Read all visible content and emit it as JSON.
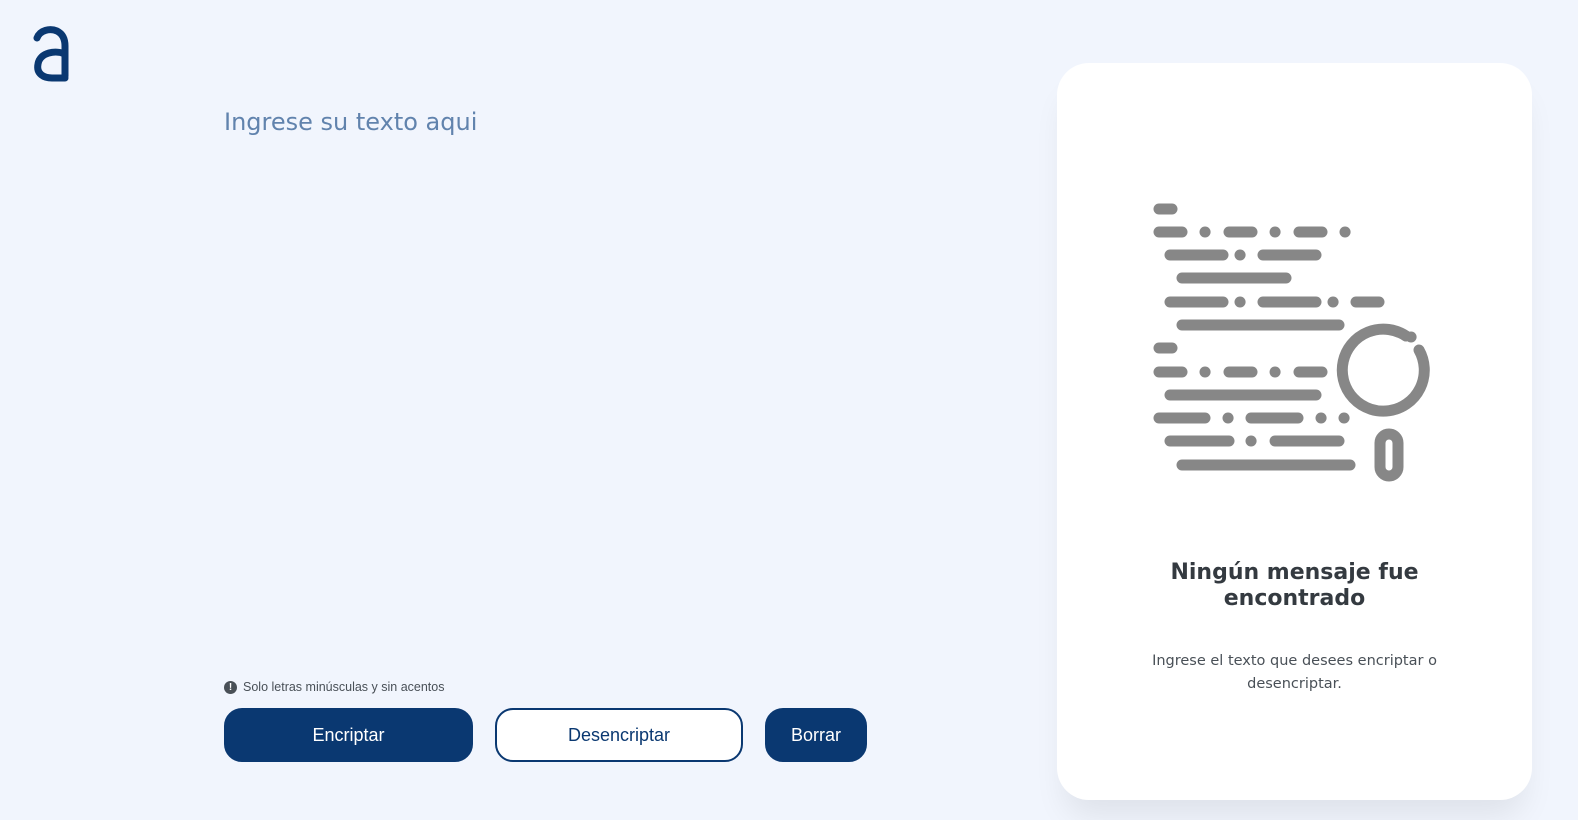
{
  "logo": {
    "icon": "alura-logo-icon",
    "color": "#0a3871"
  },
  "input": {
    "placeholder": "Ingrese su texto aqui",
    "value": ""
  },
  "hint": {
    "icon": "exclamation-circle-icon",
    "text": "Solo letras minúsculas y sin acentos"
  },
  "buttons": {
    "encrypt_label": "Encriptar",
    "decrypt_label": "Desencriptar",
    "clear_label": "Borrar"
  },
  "output_panel": {
    "illustration": "document-search-icon",
    "title_line1": "Ningún mensaje fue",
    "title_line2": "encontrado",
    "description": "Ingrese el texto que desees encriptar o desencriptar."
  },
  "colors": {
    "background": "#f1f5fd",
    "accent": "#0a3871",
    "placeholder": "#6183ad",
    "illustration": "#878787"
  }
}
